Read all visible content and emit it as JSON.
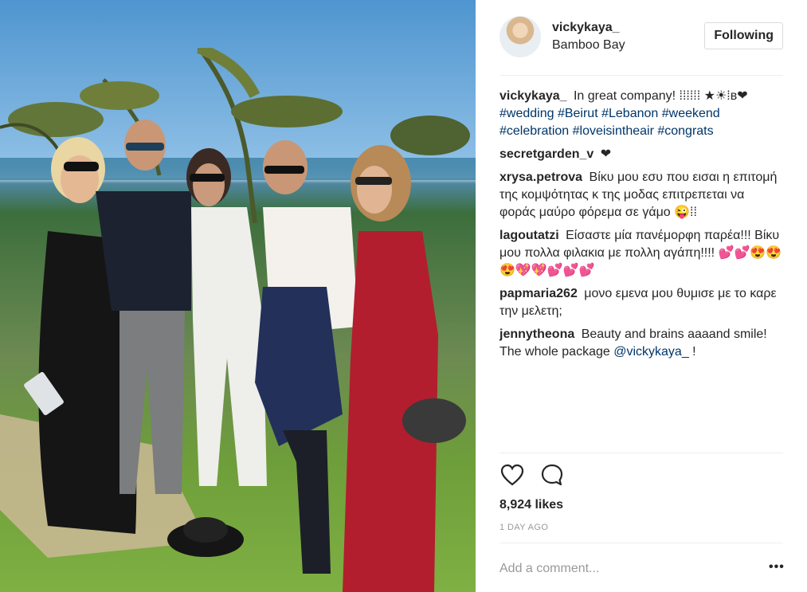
{
  "post_image": {
    "alt": ""
  },
  "header": {
    "username": "vickykaya_",
    "location": "Bamboo Bay",
    "follow_label": "Following",
    "avatar_icon": "profile-avatar"
  },
  "comments": [
    {
      "user": "vickykaya_",
      "text": "In great company! ⁞⁞⁞⁞⁞⁞ ★☀⁞ʙ❤",
      "hashtags": [
        "#wedding",
        "#Beirut",
        "#Lebanon",
        "#weekend",
        "#celebration",
        "#loveisintheair",
        "#congrats"
      ]
    },
    {
      "user": "secretgarden_v",
      "text": "❤"
    },
    {
      "user": "xrysa.petrova",
      "text": "Βίκυ μου εσυ που εισαι η επιτομή της κομψότητας κ της μοδας επιτρεπεται να φοράς μαύρο φόρεμα σε γάμο 😜⁞⁞"
    },
    {
      "user": "lagoutatzi",
      "text": "Είσαστε μία πανέμορφη παρέα!!! Βίκυ μου πολλα φιλακια με πολλη αγάπη!!!! 💕💕😍😍😍💖💖💕💕💕"
    },
    {
      "user": "papmaria262",
      "text": "μονο εμενα μου θυμισε με το καρε την μελετη;"
    },
    {
      "user": "jennytheona",
      "text": "Beauty and brains aaaand smile! The whole package",
      "mention": "@vickykaya_",
      "suffix": " !"
    }
  ],
  "actions": {
    "like_icon": "heart-icon",
    "comment_icon": "comment-bubble-icon"
  },
  "likes": "8,924 likes",
  "time": "1 DAY AGO",
  "comment_box": {
    "placeholder": "Add a comment..."
  },
  "more_label": "•••",
  "colors": {
    "link": "#003569",
    "text": "#262626",
    "muted": "#999999",
    "border": "#efefef"
  }
}
